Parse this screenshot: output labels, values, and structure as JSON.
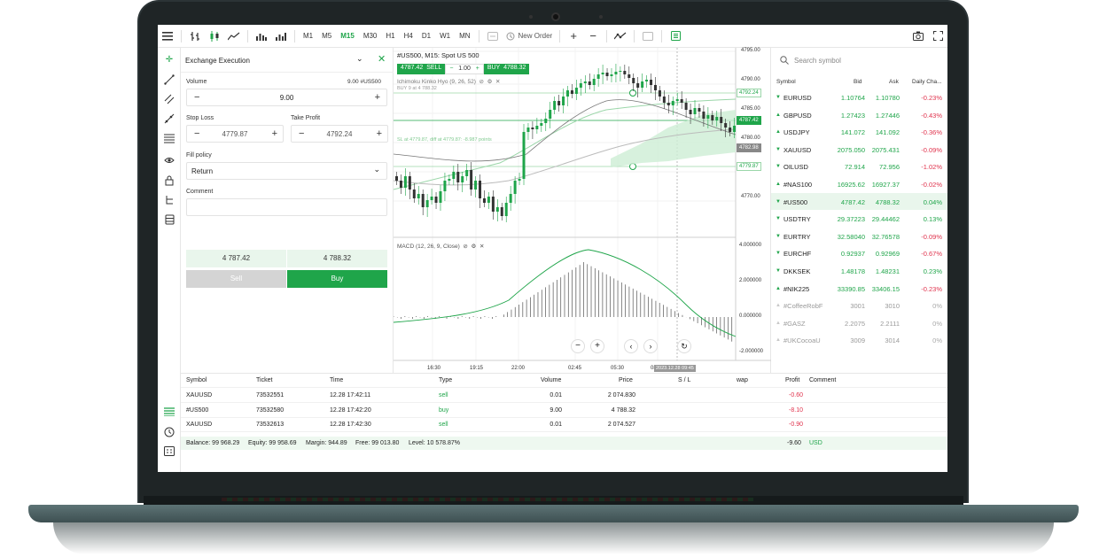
{
  "colors": {
    "accent": "#1fa54a",
    "negative": "#e0334d",
    "sell_disabled": "#d4d4d4"
  },
  "toolbar": {
    "timeframes": [
      "M1",
      "M5",
      "M15",
      "M30",
      "H1",
      "H4",
      "D1",
      "W1",
      "MN"
    ],
    "active_timeframe": "M15",
    "new_order_label": "New Order",
    "icons": [
      "menu-icon",
      "bar-chart-icon",
      "candlestick-icon",
      "line-chart-icon",
      "volume-bars-icon",
      "plus-icon",
      "minus-icon",
      "indicator-icon",
      "grid-icon",
      "order-list-icon",
      "screenshot-icon",
      "fullscreen-icon"
    ]
  },
  "order_panel": {
    "title": "Exchange Execution",
    "volume_label": "Volume",
    "volume_hint": "9.00 #US500",
    "volume_value": "9.00",
    "stop_loss_label": "Stop Loss",
    "stop_loss_value": "4779.87",
    "take_profit_label": "Take Profit",
    "take_profit_value": "4792.24",
    "fill_policy_label": "Fill policy",
    "fill_policy_value": "Return",
    "comment_label": "Comment",
    "bid_price": "4 787.42",
    "ask_price": "4 788.32",
    "sell_label": "Sell",
    "buy_label": "Buy"
  },
  "chart": {
    "symbol_title": "#US500, M15: Spot US 500",
    "sell_price": "4787.42",
    "sell_label": "SELL",
    "lot": "1.00",
    "buy_label": "BUY",
    "buy_price": "4788.32",
    "indicator_main": "Ichimoku Kinko Hyo (9, 26, 52)",
    "buy_note": "BUY 9 at 4 788.32",
    "sl_note": "SL at 4779.87, diff at 4779.87: -8.987 points",
    "indicator_sub": "MACD (12, 26, 9, Close)",
    "price_ticks": [
      "4795.00",
      "4790.00",
      "4785.00",
      "4780.00",
      "4775.00",
      "4770.00"
    ],
    "price_tags": [
      "4792.24",
      "4787.42",
      "4782.98",
      "4779.87"
    ],
    "macd_ticks": [
      "4.000000",
      "2.000000",
      "0.000000",
      "-2.000000"
    ],
    "time_ticks": [
      "16:30",
      "19:15",
      "22:00",
      "02:45",
      "05:30",
      "08:15"
    ],
    "crosshair_time": "2023.12.28 09:45"
  },
  "watchlist": {
    "search_placeholder": "Search symbol",
    "headers": [
      "Symbol",
      "Bid",
      "Ask",
      "Daily Cha..."
    ],
    "rows": [
      {
        "symbol": "EURUSD",
        "bid": "1.10764",
        "ask": "1.10780",
        "change": "-0.23%",
        "dir": "down"
      },
      {
        "symbol": "GBPUSD",
        "bid": "1.27423",
        "ask": "1.27446",
        "change": "-0.43%",
        "dir": "up"
      },
      {
        "symbol": "USDJPY",
        "bid": "141.072",
        "ask": "141.092",
        "change": "-0.36%",
        "dir": "up"
      },
      {
        "symbol": "XAUUSD",
        "bid": "2075.050",
        "ask": "2075.431",
        "change": "-0.09%",
        "dir": "down"
      },
      {
        "symbol": "OILUSD",
        "bid": "72.914",
        "ask": "72.956",
        "change": "-1.02%",
        "dir": "down"
      },
      {
        "symbol": "#NAS100",
        "bid": "16925.62",
        "ask": "16927.37",
        "change": "-0.02%",
        "dir": "up"
      },
      {
        "symbol": "#US500",
        "bid": "4787.42",
        "ask": "4788.32",
        "change": "0.04%",
        "dir": "down"
      },
      {
        "symbol": "USDTRY",
        "bid": "29.37223",
        "ask": "29.44462",
        "change": "0.13%",
        "dir": "down"
      },
      {
        "symbol": "EURTRY",
        "bid": "32.58040",
        "ask": "32.76578",
        "change": "-0.09%",
        "dir": "down"
      },
      {
        "symbol": "EURCHF",
        "bid": "0.92937",
        "ask": "0.92969",
        "change": "-0.67%",
        "dir": "down"
      },
      {
        "symbol": "DKKSEK",
        "bid": "1.48178",
        "ask": "1.48231",
        "change": "0.23%",
        "dir": "down"
      },
      {
        "symbol": "#NIK225",
        "bid": "33390.85",
        "ask": "33406.15",
        "change": "-0.23%",
        "dir": "up"
      },
      {
        "symbol": "#CoffeeRobF",
        "bid": "3001",
        "ask": "3010",
        "change": "0%",
        "dir": "none"
      },
      {
        "symbol": "#GASZ",
        "bid": "2.2075",
        "ask": "2.2111",
        "change": "0%",
        "dir": "none"
      },
      {
        "symbol": "#UKCocoaU",
        "bid": "3009",
        "ask": "3014",
        "change": "0%",
        "dir": "none"
      }
    ]
  },
  "positions": {
    "headers": {
      "symbol": "Symbol",
      "ticket": "Ticket",
      "time": "Time",
      "type": "Type",
      "volume": "Volume",
      "price": "Price",
      "sl_tp": "S / L",
      "swap": "wap",
      "profit": "Profit",
      "comment": "Comment"
    },
    "rows": [
      {
        "symbol": "XAUUSD",
        "ticket": "73532551",
        "time": "12.28 17:42:11",
        "type": "sell",
        "volume": "0.01",
        "price": "2 074.830",
        "profit": "-0.60"
      },
      {
        "symbol": "#US500",
        "ticket": "73532580",
        "time": "12.28 17:42:20",
        "type": "buy",
        "volume": "9.00",
        "price": "4 788.32",
        "profit": "-8.10"
      },
      {
        "symbol": "XAUUSD",
        "ticket": "73532613",
        "time": "12.28 17:42:30",
        "type": "sell",
        "volume": "0.01",
        "price": "2 074.527",
        "profit": "-0.90"
      }
    ],
    "footer": {
      "balance": "Balance: 99 968.29",
      "equity": "Equity: 99 958.69",
      "margin": "Margin: 944.89",
      "free": "Free: 99 013.80",
      "level": "Level: 10 578.87%",
      "total_profit": "-9.60",
      "currency": "USD"
    }
  }
}
